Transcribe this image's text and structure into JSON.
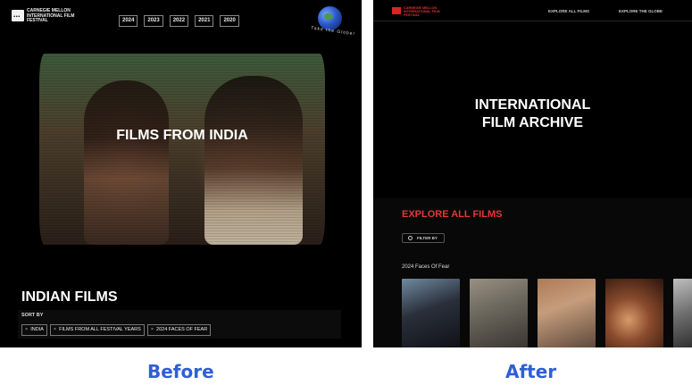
{
  "captions": {
    "before": "Before",
    "after": "After"
  },
  "before": {
    "logo_text": "CARNEGIE MELLON INTERNATIONAL FILM FESTIVAL",
    "years": [
      "2024",
      "2023",
      "2022",
      "2021",
      "2020"
    ],
    "globe_label": "Take the Globe!",
    "hero_title": "FILMS FROM INDIA",
    "heading": "INDIAN FILMS",
    "sort_label": "SORT BY",
    "chips": [
      "INDIA",
      "FILMS FROM ALL FESTIVAL YEARS",
      "2024 FACES OF FEAR"
    ],
    "chip_remove_glyph": "×"
  },
  "after": {
    "logo_text": "CARNEGIE MELLON INTERNATIONAL FILM FESTIVAL",
    "nav": {
      "explore_all": "EXPLORE ALL FILMS",
      "explore_globe": "EXPLORE THE GLOBE"
    },
    "hero_title_line1": "INTERNATIONAL",
    "hero_title_line2": "FILM ARCHIVE",
    "explore_heading": "EXPLORE ALL FILMS",
    "filter_label": "FILTER BY",
    "row_title": "2024 Faces Of Fear",
    "posters": [
      "poster-1",
      "poster-2",
      "poster-3",
      "poster-4",
      "poster-5"
    ],
    "colors": {
      "accent": "#e63636",
      "caption": "#2f5fd6"
    }
  }
}
